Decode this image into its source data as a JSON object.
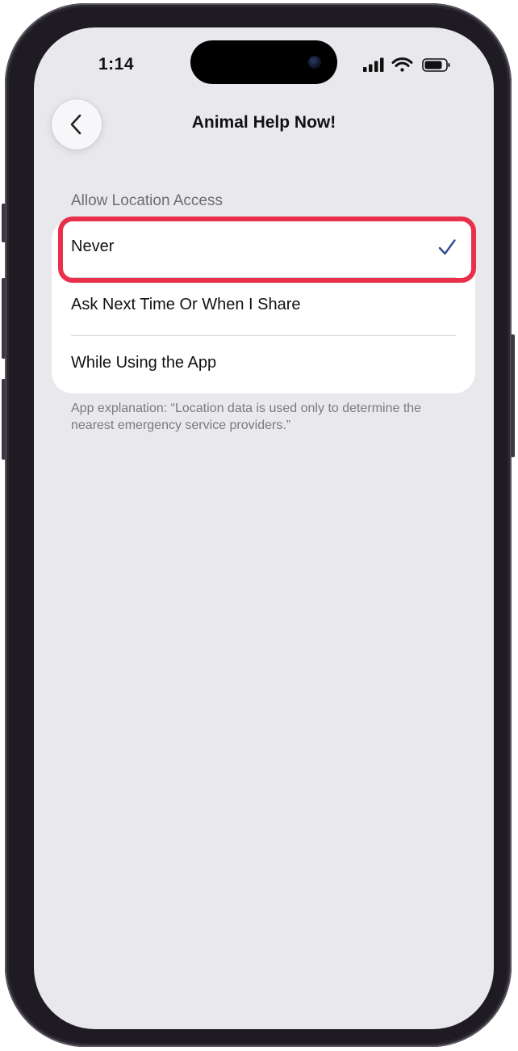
{
  "status_bar": {
    "time": "1:14",
    "icons": [
      "signal-icon",
      "wifi-icon",
      "battery-icon"
    ]
  },
  "nav": {
    "back_icon": "chevron-left-icon",
    "title": "Animal Help Now!"
  },
  "section": {
    "header": "Allow Location Access",
    "options": [
      {
        "label": "Never",
        "selected": true
      },
      {
        "label": "Ask Next Time Or When I Share",
        "selected": false
      },
      {
        "label": "While Using the App",
        "selected": false
      }
    ],
    "footer": "App explanation: “Location data is used only to determine the nearest emergency service providers.”"
  },
  "colors": {
    "checkmark": "#2f4e93",
    "highlight": "#e8304b",
    "background": "#e9e8ed"
  }
}
